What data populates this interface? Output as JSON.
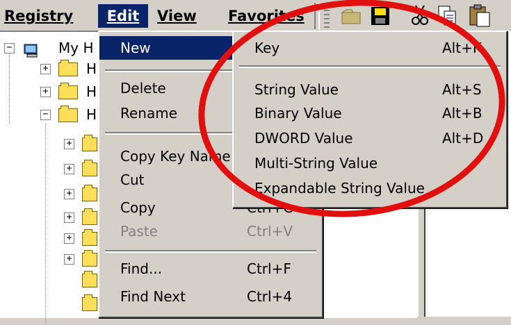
{
  "menubar": {
    "registry": "Registry",
    "edit": "Edit",
    "view": "View",
    "favorites": "Favorites"
  },
  "tree": {
    "root_label": "My H",
    "node_label": "H"
  },
  "edit_menu": {
    "items": [
      {
        "label": "New",
        "shortcut": ""
      },
      {
        "label": "Delete",
        "shortcut": ""
      },
      {
        "label": "Rename",
        "shortcut": ""
      },
      {
        "label": "Copy Key Name",
        "shortcut": ""
      },
      {
        "label": "Cut",
        "shortcut": ""
      },
      {
        "label": "Copy",
        "shortcut": "Ctrl+C"
      },
      {
        "label": "Paste",
        "shortcut": "Ctrl+V"
      },
      {
        "label": "Find...",
        "shortcut": "Ctrl+F"
      },
      {
        "label": "Find Next",
        "shortcut": "Ctrl+4"
      }
    ]
  },
  "new_menu": {
    "items": [
      {
        "label": "Key",
        "shortcut": "Alt+K"
      },
      {
        "label": "String Value",
        "shortcut": "Alt+S"
      },
      {
        "label": "Binary Value",
        "shortcut": "Alt+B"
      },
      {
        "label": "DWORD Value",
        "shortcut": "Alt+D"
      },
      {
        "label": "Multi-String Value",
        "shortcut": ""
      },
      {
        "label": "Expandable String Value",
        "shortcut": ""
      }
    ]
  },
  "toolbar": {
    "icons": [
      "open-folder-icon",
      "save-icon",
      "cut-icon",
      "copy-icon",
      "paste-icon"
    ]
  },
  "colors": {
    "highlight": "#0a246a",
    "annotation_circle": "#e20f0f",
    "face": "#d4d0c8"
  }
}
